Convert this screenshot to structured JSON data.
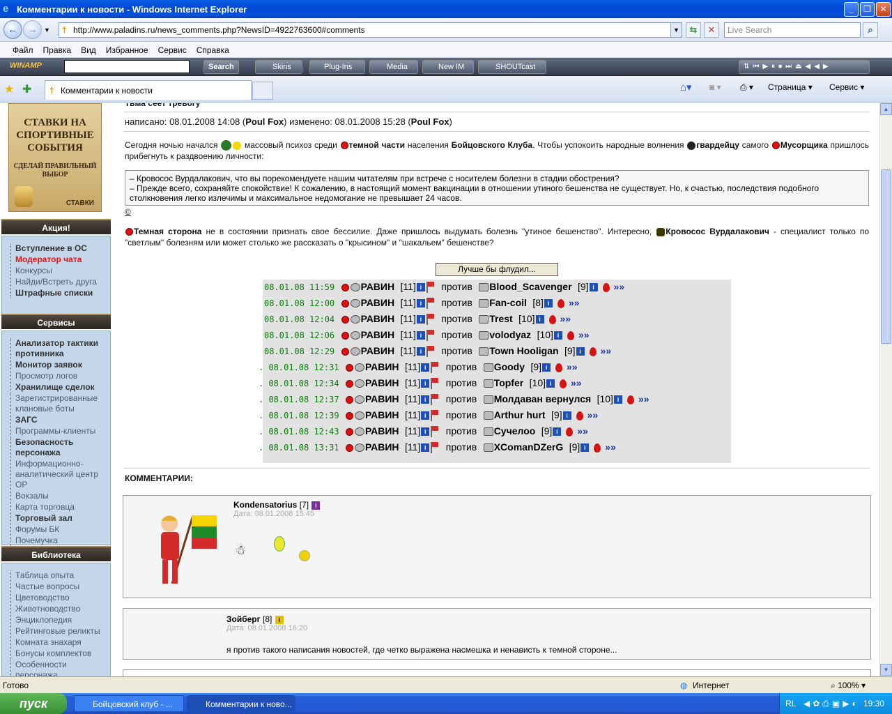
{
  "window": {
    "title": "Комментарии к новости - Windows Internet Explorer"
  },
  "address": {
    "url": "http://www.paladins.ru/news_comments.php?NewsID=4922763600#comments",
    "search_placeholder": "Live Search"
  },
  "menu": [
    "Файл",
    "Правка",
    "Вид",
    "Избранное",
    "Сервис",
    "Справка"
  ],
  "winamp": {
    "logo": "WINAMP",
    "search_btn": "Search",
    "skins": "Skins",
    "plugins": "Plug-Ins",
    "media": "Media",
    "newim": "New IM",
    "shoutcast": "SHOUTcast"
  },
  "tabs": {
    "active": "Комментарии к новости",
    "page_menu": "Страница",
    "service_menu": "Сервис"
  },
  "ad": {
    "line1": "СТАВКИ НА",
    "line2": "СПОРТИВНЫЕ",
    "line3": "СОБЫТИЯ",
    "line4": "СДЕЛАЙ ПРАВИЛЬНЫЙ",
    "line5": "ВЫБОР",
    "line6": "СТАВКИ"
  },
  "sidebar": {
    "section1": {
      "title": "Акция!",
      "items": [
        "Вступление в ОС",
        "Модератор чата",
        "Конкурсы",
        "Найди/Встреть друга",
        "Штрафные списки"
      ]
    },
    "section2": {
      "title": "Сервисы",
      "items": [
        "Анализатор тактики противника",
        "Монитор заявок",
        "Просмотр логов",
        "Хранилище сделок",
        "Зарегистрированные клановые боты",
        "ЗАГС",
        "Программы-клиенты",
        "Безопасность персонажа",
        "Информационно-аналитический центр ОР",
        "Вокзалы",
        "Карта торговца",
        "Торговый зал",
        "Форумы БК",
        "Почемучка"
      ]
    },
    "section3": {
      "title": "Библиотека",
      "items": [
        "Таблица опыта",
        "Частые вопросы",
        "Цветоводство",
        "Животноводство",
        "Энциклопедия",
        "Рейтинговые реликты",
        "Комната знахаря",
        "Бонусы комплектов",
        "Особенности персонажа"
      ]
    }
  },
  "article": {
    "title_fragment": "Тьма сеет тревогу",
    "written_label": "написано: 08.01.2008 14:08 (",
    "author": "Poul Fox",
    "edited_label": ") изменено: 08.01.2008 15:28 (",
    "editor": "Poul Fox",
    "close": ")",
    "p1_a": "Сегодня ночью начался",
    "p1_b": "массовый психоз среди",
    "p1_c": "темной части",
    "p1_d": "населения",
    "p1_e": "Бойцовского Клуба",
    "p1_f": ". Чтобы успокоить народные волнения",
    "p1_g": "гвардейцу",
    "p1_h": "самого",
    "p1_i": "Мусорщика",
    "p1_j": "пришлось прибегнуть к раздвоению личности:",
    "quote1": "– Кровосос Вурдалакович, что вы порекомендуете нашим читателям при встрече с носителем болезни в стадии обострения?",
    "quote2": "– Прежде всего, сохраняйте спокойствие! К сожалению, в настоящий момент вакцинации в отношении утиного бешенства не существует. Но, к счастью, последствия подобного столкновения легко излечимы и максимальное недомогание не превышает 24 часов.",
    "copy": "©",
    "p2_a": "Темная сторона",
    "p2_b": "не в состоянии признать свое бессилие. Даже пришлось выдумать болезнь \"утиное бешенство\". Интересно,",
    "p2_c": "Кровосос Вурдалакович",
    "p2_d": "- специалист только по \"светлым\" болезням или может столько же рассказать о \"крысином\" и \"шакальем\" бешенстве?",
    "flood_button": "Лучше бы флудил..."
  },
  "fights": [
    {
      "time": "08.01.08 11:59",
      "player": "РАВИН",
      "level": "[11]",
      "vs": "против",
      "opp": "Blood_Scavenger",
      "opp_level": "[9]",
      "arrow": "»»"
    },
    {
      "time": "08.01.08 12:00",
      "player": "РАВИН",
      "level": "[11]",
      "vs": "против",
      "opp": "Fan-coil",
      "opp_level": "[8]",
      "arrow": "»»"
    },
    {
      "time": "08.01.08 12:04",
      "player": "РАВИН",
      "level": "[11]",
      "vs": "против",
      "opp": "Trest",
      "opp_level": "[10]",
      "arrow": "»»"
    },
    {
      "time": "08.01.08 12:06",
      "player": "РАВИН",
      "level": "[11]",
      "vs": "против",
      "opp": "volodyaz",
      "opp_level": "[10]",
      "arrow": "»»"
    },
    {
      "time": "08.01.08 12:29",
      "player": "РАВИН",
      "level": "[11]",
      "vs": "против",
      "opp": "Town Hooligan",
      "opp_level": "[9]",
      "arrow": "»»"
    },
    {
      "time": ". 08.01.08 12:31",
      "player": "РАВИН",
      "level": "[11]",
      "vs": "против",
      "opp": "Goody",
      "opp_level": "[9]",
      "arrow": "»»"
    },
    {
      "time": ". 08.01.08 12:34",
      "player": "РАВИН",
      "level": "[11]",
      "vs": "против",
      "opp": "Topfer",
      "opp_level": "[10]",
      "arrow": "»»"
    },
    {
      "time": ". 08.01.08 12:37",
      "player": "РАВИН",
      "level": "[11]",
      "vs": "против",
      "opp": "Молдаван вернулся",
      "opp_level": "[10]",
      "arrow": "»»"
    },
    {
      "time": ". 08.01.08 12:39",
      "player": "РАВИН",
      "level": "[11]",
      "vs": "против",
      "opp": "Arthur hurt",
      "opp_level": "[9]",
      "arrow": "»»"
    },
    {
      "time": ". 08.01.08 12:43",
      "player": "РАВИН",
      "level": "[11]",
      "vs": "против",
      "opp": "Сучелоо",
      "opp_level": "[9]",
      "arrow": "»»"
    },
    {
      "time": ". 08.01.08 13:31",
      "player": "РАВИН",
      "level": "[11]",
      "vs": "против",
      "opp": "XComanDZerG",
      "opp_level": "[9]",
      "arrow": "»»"
    }
  ],
  "comments_title": "КОММЕНТАРИИ:",
  "comments": [
    {
      "name": "Kondensatorius",
      "level": "[7]",
      "date": "Дата: 08.01.2008 15:45",
      "text": ""
    },
    {
      "name": "Зойберг",
      "level": "[8]",
      "date": "Дата: 08.01.2008 16:20",
      "text": "я против такого написания новостей, где четко выражена насмешка и ненависть к темной стороне..."
    }
  ],
  "status": {
    "left": "Готово",
    "zone": "Интернет",
    "zoom": "100%"
  },
  "taskbar": {
    "start": "пуск",
    "task1": "Бойцовский клуб - ...",
    "task2": "Комментарии к ново...",
    "lang": "RL",
    "clock": "19:30"
  },
  "colors": {
    "link_red": "#e41313",
    "timestamp_green": "#0a7a0a",
    "sidebar_bg": "#c4d6ea"
  }
}
